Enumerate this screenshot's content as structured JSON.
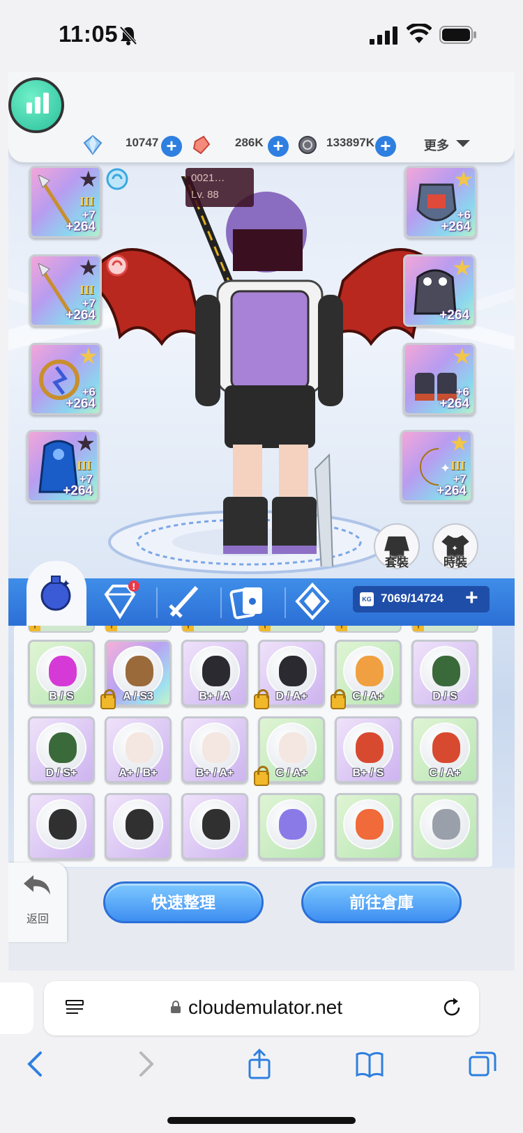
{
  "status_bar": {
    "time": "11:05"
  },
  "currencies": [
    {
      "icon": "diamond-icon",
      "amount": "10747"
    },
    {
      "icon": "red-crystal-icon",
      "amount": "286K"
    },
    {
      "icon": "coin-icon",
      "amount": "133897K"
    }
  ],
  "more_label": "更多",
  "character": {
    "name": "0021…",
    "level": "Lv. 88"
  },
  "equipment_left": [
    {
      "icon": "spear-icon",
      "tier": "III",
      "enhance": "+7",
      "refine": "+264"
    },
    {
      "icon": "spear-icon",
      "tier": "III",
      "enhance": "+7",
      "refine": "+264"
    },
    {
      "icon": "amulet-icon",
      "tier": "",
      "enhance": "+6",
      "refine": "+264"
    },
    {
      "icon": "cloak-icon",
      "tier": "III",
      "enhance": "+7",
      "refine": "+264"
    }
  ],
  "equipment_right": [
    {
      "icon": "armor-icon",
      "tier": "",
      "enhance": "+6",
      "refine": "+264"
    },
    {
      "icon": "garment-icon",
      "tier": "",
      "enhance": "",
      "refine": "+264"
    },
    {
      "icon": "shoes-icon",
      "tier": "",
      "enhance": "+6",
      "refine": "+264"
    },
    {
      "icon": "moon-accessory-icon",
      "tier": "III",
      "enhance": "+7",
      "refine": "+264"
    }
  ],
  "costume_buttons": {
    "set": "套裝",
    "fashion": "時裝"
  },
  "inventory": {
    "capacity": "7069/14724",
    "rows": [
      [
        {
          "color": "green",
          "grade": "B / S",
          "locked": false,
          "creature": "robot-pet-icon"
        },
        {
          "color": "rainbow",
          "grade": "A / S3",
          "locked": true,
          "creature": "warrior-girl-icon"
        },
        {
          "color": "purple",
          "grade": "B+ / A",
          "locked": false,
          "creature": "dark-beast-icon"
        },
        {
          "color": "purple",
          "grade": "D / A+",
          "locked": true,
          "creature": "dark-beast-icon"
        },
        {
          "color": "green",
          "grade": "C / A+",
          "locked": true,
          "creature": "lion-cub-icon"
        },
        {
          "color": "purple",
          "grade": "D / S",
          "locked": false,
          "creature": "mask-spirit-icon"
        }
      ],
      [
        {
          "color": "purple",
          "grade": "D / S+",
          "locked": false,
          "creature": "mask-spirit-icon"
        },
        {
          "color": "purple",
          "grade": "A+ / B+",
          "locked": false,
          "creature": "rabbit-icon"
        },
        {
          "color": "purple",
          "grade": "B+ / A+",
          "locked": false,
          "creature": "rabbit-icon"
        },
        {
          "color": "green",
          "grade": "C / A+",
          "locked": true,
          "creature": "rabbit-icon"
        },
        {
          "color": "purple",
          "grade": "B+ / S",
          "locked": false,
          "creature": "dragon-icon"
        },
        {
          "color": "green",
          "grade": "C / A+",
          "locked": false,
          "creature": "dragon-icon"
        }
      ],
      [
        {
          "color": "purple",
          "grade": "",
          "locked": false,
          "creature": "panda-icon"
        },
        {
          "color": "purple",
          "grade": "",
          "locked": false,
          "creature": "panda-icon"
        },
        {
          "color": "purple",
          "grade": "",
          "locked": false,
          "creature": "panda-icon"
        },
        {
          "color": "green",
          "grade": "",
          "locked": false,
          "creature": "wind-orb-icon"
        },
        {
          "color": "green",
          "grade": "",
          "locked": false,
          "creature": "fire-orb-icon"
        },
        {
          "color": "green",
          "grade": "",
          "locked": false,
          "creature": "storm-orb-icon"
        }
      ]
    ]
  },
  "back_label": "返回",
  "actions": {
    "quick_sort": "快速整理",
    "go_warehouse": "前往倉庫"
  },
  "browser": {
    "url": "cloudemulator.net"
  },
  "colors": {
    "accent": "#2e7fe0",
    "tab_bar": "#3f8ee8"
  }
}
